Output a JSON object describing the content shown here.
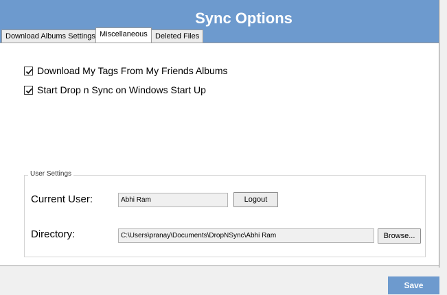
{
  "window": {
    "title": "Sync Options"
  },
  "tabs": [
    {
      "label": "Download Albums Settings",
      "active": false
    },
    {
      "label": "Miscellaneous",
      "active": true
    },
    {
      "label": "Deleted Files",
      "active": false
    }
  ],
  "options": [
    {
      "label": "Download My Tags From My Friends Albums",
      "checked": true
    },
    {
      "label": "Start Drop n Sync on Windows Start Up",
      "checked": true
    }
  ],
  "user_settings": {
    "group_label": "User Settings",
    "current_user_label": "Current User:",
    "current_user_value": "Abhi Ram",
    "logout_label": "Logout",
    "directory_label": "Directory:",
    "directory_value": "C:\\Users\\pranay\\Documents\\DropNSync\\Abhi Ram",
    "browse_label": "Browse..."
  },
  "footer": {
    "save_label": "Save"
  },
  "colors": {
    "header_bg": "#6d9ace",
    "save_bg": "#6d9ace"
  },
  "icons": {
    "checkbox": "checkmark-icon"
  }
}
